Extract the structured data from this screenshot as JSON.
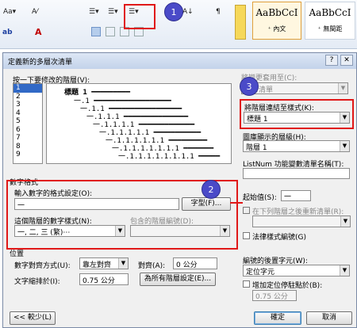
{
  "ribbon": {
    "font_size": "Aa▾",
    "clear_format": "A⁄",
    "list_bullets": "☰▾",
    "list_numbers": "☰▾",
    "list_multilevel": "☰▾",
    "sort": "A↓",
    "para_mark": "¶",
    "style1_sample": "AaBbCcI",
    "style1_caption": "⁺ 內文",
    "style2_sample": "AaBbCcI",
    "style2_caption": "⁺ 無間距",
    "font_color": "A",
    "highlight": "ab"
  },
  "dialog": {
    "title": "定義新的多層次清單",
    "help": "?",
    "close": "✕",
    "level_label": "按一下要修改的階層(V):",
    "levels": [
      "1",
      "2",
      "3",
      "4",
      "5",
      "6",
      "7",
      "8",
      "9"
    ],
    "selected_level": "1",
    "preview_items": [
      "標題 1 ━━━━━━━━━",
      "一.1 ━━━━━━━━━━━━━━━━━━",
      "一.1.1 ━━━━━━━━━━━━━━━━━",
      "一.1.1.1 ━━━━━━━━━━━━━━━",
      "一.1.1.1.1 ━━━━━━━━━━━━━",
      "一.1.1.1.1.1 ━━━━━━━━━━━",
      "一.1.1.1.1.1.1 ━━━━━━━━━",
      "一.1.1.1.1.1.1.1 ━━━━━━━",
      "一.1.1.1.1.1.1.1.1 ━━━━━"
    ],
    "apply_label": "將變更套用至(C):",
    "apply_value": "整份清單",
    "link_style_label": "將階層連結至樣式(K):",
    "link_style_value": "標題 1",
    "gallery_level_label": "圖庫顯示的層級(H):",
    "gallery_level_value": "階層 1",
    "listnum_label": "ListNum 功能變數清單名稱(T):",
    "number_format_section": "數字格式",
    "enter_format_label": "輸入數字的格式設定(O):",
    "enter_format_value": "一",
    "font_button": "字型(F)...",
    "number_style_label": "這個階層的數字樣式(N):",
    "number_style_value": "一, 二, 三 (繁)⋯",
    "include_level_label": "包含的階層編號(D):",
    "start_at_label": "起始值(S):",
    "start_at_value": "一",
    "restart_label": "在下列階層之後重新清單(R):",
    "legal_label": "法律樣式編號(G)",
    "position_section": "位置",
    "align_label": "數字對齊方式(U):",
    "align_value": "靠左對齊",
    "aligned_at_label": "對齊(A):",
    "aligned_at_value": "0 公分",
    "indent_label": "文字縮排於(I):",
    "indent_value": "0.75 公分",
    "set_all_button": "為所有階層設定(E)...",
    "follow_label": "編號的後置字元(W):",
    "follow_value": "定位字元",
    "add_tab_label": "增加定位停駐點於(B):",
    "tab_value": "0.75 公分",
    "less_button": "<< 較少(L)",
    "ok_button": "確定",
    "cancel_button": "取消"
  },
  "callouts": [
    "1",
    "2",
    "3"
  ]
}
